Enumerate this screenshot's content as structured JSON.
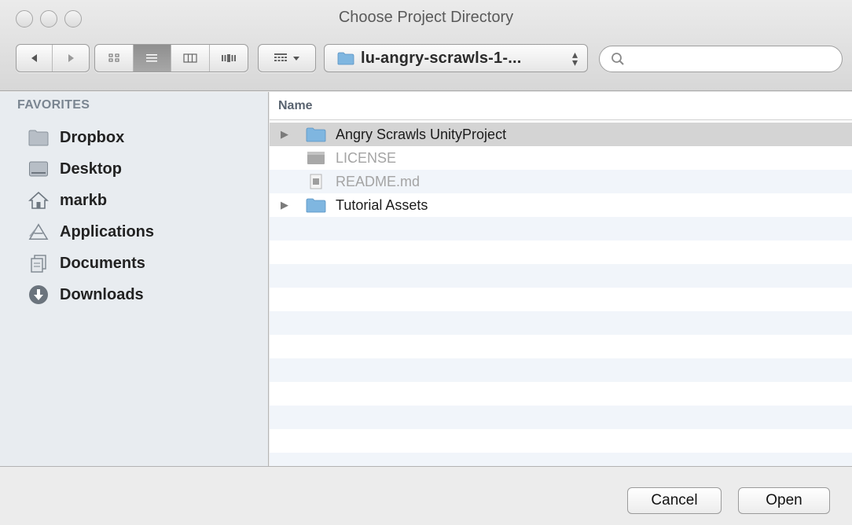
{
  "window": {
    "title": "Choose Project Directory"
  },
  "toolbar": {
    "path_label": "lu-angry-scrawls-1-...",
    "search_placeholder": "",
    "search_value": ""
  },
  "sidebar": {
    "section_title": "FAVORITES",
    "items": [
      {
        "label": "Dropbox",
        "icon": "folder-icon"
      },
      {
        "label": "Desktop",
        "icon": "desktop-icon"
      },
      {
        "label": "markb",
        "icon": "home-icon"
      },
      {
        "label": "Applications",
        "icon": "applications-icon"
      },
      {
        "label": "Documents",
        "icon": "documents-icon"
      },
      {
        "label": "Downloads",
        "icon": "downloads-icon"
      }
    ]
  },
  "filelist": {
    "column_name": "Name",
    "rows": [
      {
        "name": "Angry Scrawls UnityProject",
        "type": "folder",
        "expandable": true,
        "selected": true,
        "dimmed": false
      },
      {
        "name": "LICENSE",
        "type": "file",
        "expandable": false,
        "selected": false,
        "dimmed": true
      },
      {
        "name": "README.md",
        "type": "document",
        "expandable": false,
        "selected": false,
        "dimmed": true
      },
      {
        "name": "Tutorial Assets",
        "type": "folder",
        "expandable": true,
        "selected": false,
        "dimmed": false
      }
    ]
  },
  "buttons": {
    "cancel_label": "Cancel",
    "open_label": "Open"
  },
  "colors": {
    "sidebar_bg": "#e8ecf0",
    "folder_blue": "#7fb6e0",
    "row_stripe": "#f1f5fa",
    "selected_row": "#d4d4d4"
  }
}
